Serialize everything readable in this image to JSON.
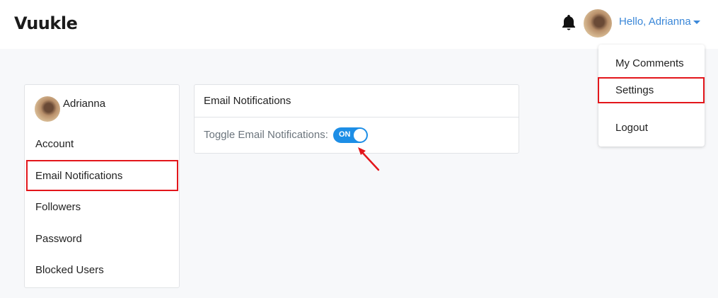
{
  "header": {
    "logo": "Vuukle",
    "greeting": "Hello, Adrianna",
    "icons": {
      "notifications": "bell-icon",
      "user_menu": "caret-down-icon"
    }
  },
  "user_menu": {
    "items": [
      {
        "label": "My Comments"
      },
      {
        "label": "Settings",
        "highlighted": true
      },
      {
        "label": "Logout"
      }
    ]
  },
  "sidebar": {
    "user_name": "Adrianna",
    "items": [
      {
        "label": "Account"
      },
      {
        "label": "Email Notifications",
        "highlighted": true
      },
      {
        "label": "Followers"
      },
      {
        "label": "Password"
      },
      {
        "label": "Blocked Users"
      }
    ]
  },
  "main": {
    "card_title": "Email Notifications",
    "toggle_label": "Toggle Email Notifications:",
    "toggle_state": "ON"
  },
  "colors": {
    "accent_link": "#3a87d8",
    "toggle_on": "#1d8ee6",
    "highlight_box": "#e3161b",
    "page_background": "#f7f8fa"
  }
}
